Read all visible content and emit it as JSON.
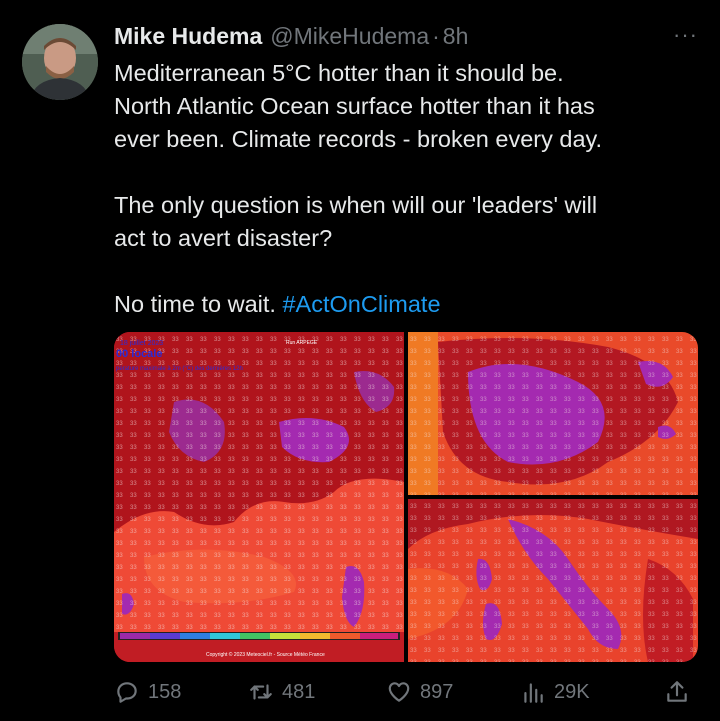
{
  "tweet": {
    "author": {
      "display_name": "Mike Hudema",
      "handle": "@MikeHudema",
      "separator": "·",
      "time": "8h"
    },
    "more_label": "···",
    "text_lines": [
      "Mediterranean 5°C hotter than it should be.",
      "North Atlantic Ocean surface hotter than it has",
      "ever been. Climate records - broken every day."
    ],
    "text_lines_2": [
      "The only question is when will our 'leaders' will",
      "act to avert disaster?"
    ],
    "closing_text": "No time to wait.",
    "hashtag": "#ActOnClimate",
    "media_label": {
      "date": "18 juillet 2023",
      "time": "00 locale",
      "caption": "pérature maximale à 2m (°C) des dernières 12h",
      "model": "Run ARPEGE",
      "credit": "Copyright © 2023 Meteociel.fr - Source Météo France"
    }
  },
  "actions": {
    "replies": "158",
    "retweets": "481",
    "likes": "897",
    "views": "29K"
  },
  "colors": {
    "background": "#000000",
    "text": "#e7e9ea",
    "muted": "#71767b",
    "link": "#1d9bf0",
    "heat_red": "#d6262a",
    "heat_orange": "#f2582c",
    "heat_magenta": "#a42ab0"
  }
}
